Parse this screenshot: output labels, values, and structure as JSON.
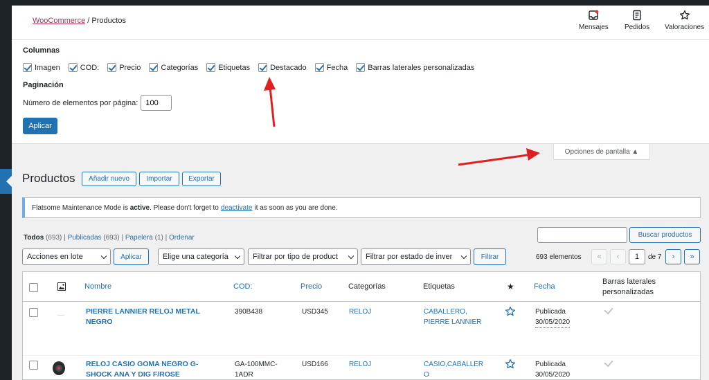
{
  "breadcrumb": {
    "parent": "WooCommerce",
    "separator": "/",
    "current": "Productos"
  },
  "activity": [
    {
      "label": "Mensajes",
      "icon": "inbox-icon"
    },
    {
      "label": "Pedidos",
      "icon": "orders-icon"
    },
    {
      "label": "Valoraciones",
      "icon": "star-icon"
    }
  ],
  "screen_options": {
    "columns_title": "Columnas",
    "columns": [
      "Imagen",
      "COD:",
      "Precio",
      "Categorías",
      "Etiquetas",
      "Destacado",
      "Fecha",
      "Barras laterales personalizadas"
    ],
    "pagination_title": "Paginación",
    "per_page_label": "Número de elementos por página:",
    "per_page_value": "100",
    "apply_label": "Aplicar",
    "toggle_label": "Opciones de pantalla ▲"
  },
  "page": {
    "title": "Productos",
    "add_new": "Añadir nuevo",
    "import": "Importar",
    "export": "Exportar"
  },
  "notice": {
    "prefix": "Flatsome Maintenance Mode is",
    "bold": "active",
    "middle": ". Please don't forget to",
    "link": "deactivate",
    "suffix": "it as soon as you are done."
  },
  "views": {
    "all": "Todos",
    "all_count": "(693)",
    "published": "Publicadas",
    "published_count": "(693)",
    "trash": "Papelera",
    "trash_count": "(1)",
    "sort": "Ordenar",
    "sep": "|"
  },
  "search_button": "Buscar productos",
  "filters": {
    "bulk_actions": "Acciones en lote",
    "apply": "Aplicar",
    "category": "Elige una categoría",
    "product_type": "Filtrar por tipo de product",
    "stock": "Filtrar por estado de inver",
    "filter": "Filtrar"
  },
  "pagination": {
    "count": "693 elementos",
    "first": "«",
    "prev": "‹",
    "current": "1",
    "of": "de 7",
    "next": "›",
    "last": "»"
  },
  "table": {
    "headers": {
      "name": "Nombre",
      "sku": "COD:",
      "price": "Precio",
      "categories": "Categorías",
      "tags": "Etiquetas",
      "featured": "★",
      "date": "Fecha",
      "sidebar_line1": "Barras laterales",
      "sidebar_line2": "personalizadas"
    },
    "rows": [
      {
        "name_line1": "PIERRE LANNIER RELOJ METAL",
        "name_line2": "NEGRO",
        "sku_line1": "390B438",
        "sku_line2": "",
        "price": "USD345",
        "category": "RELOJ",
        "tags_line1": "CABALLERO,",
        "tags_line2": "PIERRE LANNIER",
        "status": "Publicada",
        "date": "30/05/2020"
      },
      {
        "name_line1": "RELOJ CASIO GOMA NEGRO G-",
        "name_line2": "SHOCK ANA Y DIG F/ROSE",
        "sku_line1": "GA-100MMC-",
        "sku_line2": "1ADR",
        "price": "USD166",
        "category": "RELOJ",
        "tags_line1": "CASIO,CABALLER",
        "tags_line2": "O",
        "status": "Publicada",
        "date": "30/05/2020"
      }
    ]
  },
  "colors": {
    "primary": "#2271b1",
    "woo": "#a2315a",
    "admin_dark": "#1d2327",
    "annotation_arrow": "#e02020"
  }
}
